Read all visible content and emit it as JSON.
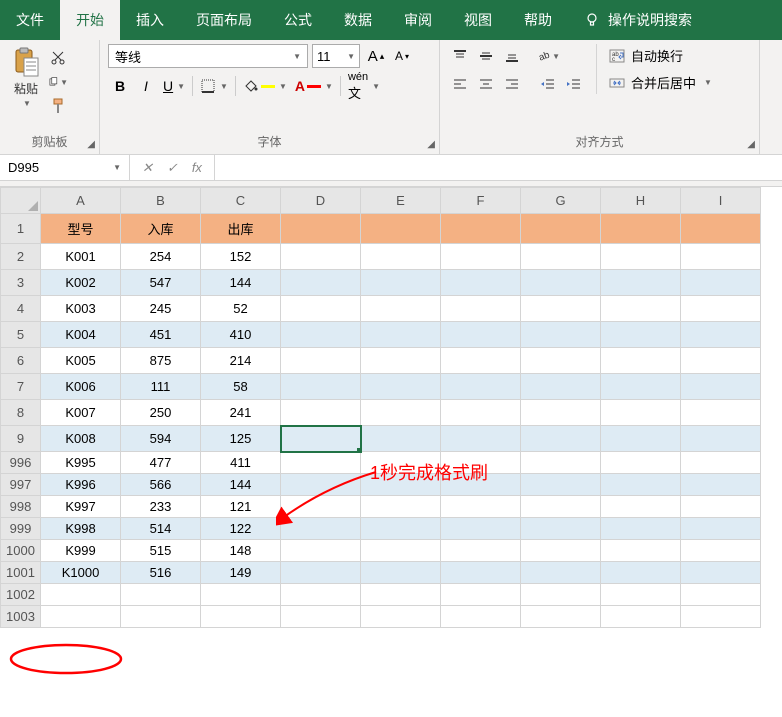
{
  "menu": {
    "items": [
      "文件",
      "开始",
      "插入",
      "页面布局",
      "公式",
      "数据",
      "审阅",
      "视图",
      "帮助"
    ],
    "active_index": 1,
    "tell_me": "操作说明搜索"
  },
  "ribbon": {
    "clipboard": {
      "paste": "粘贴",
      "label": "剪贴板"
    },
    "font": {
      "family": "等线",
      "size": "11",
      "label": "字体"
    },
    "alignment": {
      "wrap": "自动换行",
      "merge": "合并后居中",
      "label": "对齐方式"
    }
  },
  "name_box": "D995",
  "columns": [
    "A",
    "B",
    "C",
    "D",
    "E",
    "F",
    "G",
    "H",
    "I"
  ],
  "header_row": [
    "型号",
    "入库",
    "出库"
  ],
  "rows": [
    {
      "num": "1",
      "cells": [
        "型号",
        "入库",
        "出库"
      ],
      "header": true
    },
    {
      "num": "2",
      "cells": [
        "K001",
        "254",
        "152"
      ]
    },
    {
      "num": "3",
      "cells": [
        "K002",
        "547",
        "144"
      ],
      "stripe": true
    },
    {
      "num": "4",
      "cells": [
        "K003",
        "245",
        "52"
      ]
    },
    {
      "num": "5",
      "cells": [
        "K004",
        "451",
        "410"
      ],
      "stripe": true
    },
    {
      "num": "6",
      "cells": [
        "K005",
        "875",
        "214"
      ]
    },
    {
      "num": "7",
      "cells": [
        "K006",
        "111",
        "58"
      ],
      "stripe": true
    },
    {
      "num": "8",
      "cells": [
        "K007",
        "250",
        "241"
      ]
    },
    {
      "num": "9",
      "cells": [
        "K008",
        "594",
        "125"
      ],
      "stripe": true
    },
    {
      "num": "996",
      "cells": [
        "K995",
        "477",
        "411"
      ]
    },
    {
      "num": "997",
      "cells": [
        "K996",
        "566",
        "144"
      ],
      "stripe": true
    },
    {
      "num": "998",
      "cells": [
        "K997",
        "233",
        "121"
      ]
    },
    {
      "num": "999",
      "cells": [
        "K998",
        "514",
        "122"
      ],
      "stripe": true
    },
    {
      "num": "1000",
      "cells": [
        "K999",
        "515",
        "148"
      ]
    },
    {
      "num": "1001",
      "cells": [
        "K1000",
        "516",
        "149"
      ],
      "stripe": true
    },
    {
      "num": "1002",
      "cells": [
        "",
        "",
        ""
      ]
    },
    {
      "num": "1003",
      "cells": [
        "",
        "",
        ""
      ]
    }
  ],
  "row_heights": {
    "996": 22,
    "997": 22,
    "998": 22,
    "999": 22,
    "1000": 22,
    "1001": 22,
    "1002": 22,
    "1003": 22
  },
  "selected": {
    "row": "9",
    "col": "D"
  },
  "annotation": "1秒完成格式刷"
}
